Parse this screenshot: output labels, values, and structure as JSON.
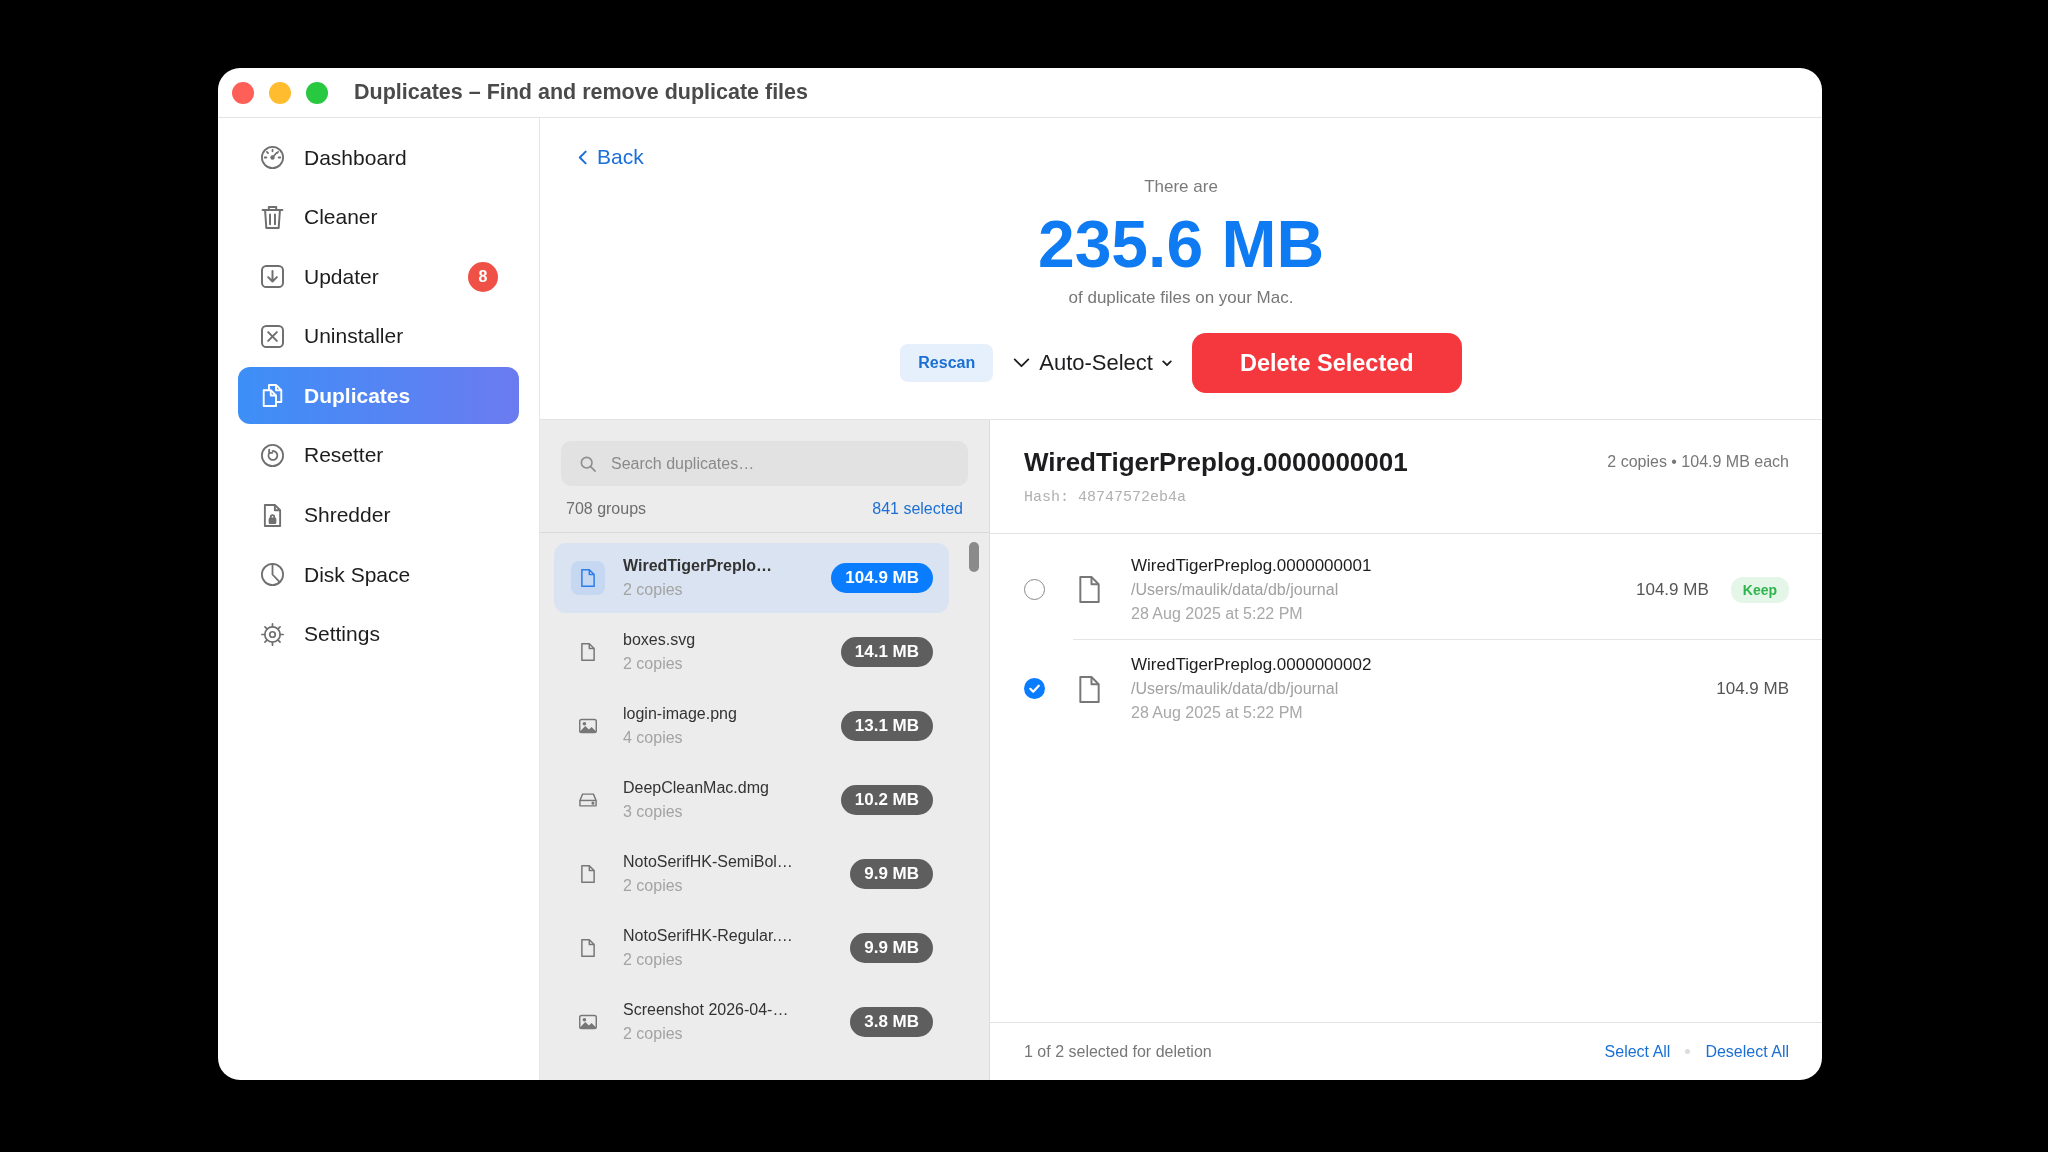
{
  "window": {
    "title": "Duplicates – Find and remove duplicate files"
  },
  "sidebar": {
    "items": [
      {
        "label": "Dashboard",
        "selected": false
      },
      {
        "label": "Cleaner",
        "selected": false
      },
      {
        "label": "Updater",
        "selected": false,
        "badge": "8"
      },
      {
        "label": "Uninstaller",
        "selected": false
      },
      {
        "label": "Duplicates",
        "selected": true
      },
      {
        "label": "Resetter",
        "selected": false
      },
      {
        "label": "Shredder",
        "selected": false
      },
      {
        "label": "Disk Space",
        "selected": false
      },
      {
        "label": "Settings",
        "selected": false
      }
    ]
  },
  "header": {
    "back": "Back",
    "intro": "There are",
    "total": "235.6 MB",
    "caption": "of duplicate files on your Mac.",
    "rescan": "Rescan",
    "auto_select": "Auto-Select",
    "delete": "Delete Selected"
  },
  "list": {
    "search": {
      "placeholder": "Search duplicates…"
    },
    "group_count": "708 groups",
    "selected_count": "841 selected",
    "rows": [
      {
        "name": "WiredTigerPreplo…",
        "copies": "2 copies",
        "size": "104.9 MB",
        "kind": "document",
        "selected": true
      },
      {
        "name": "boxes.svg",
        "copies": "2 copies",
        "size": "14.1 MB",
        "kind": "document",
        "selected": false
      },
      {
        "name": "login-image.png",
        "copies": "4 copies",
        "size": "13.1 MB",
        "kind": "image",
        "selected": false
      },
      {
        "name": "DeepCleanMac.dmg",
        "copies": "3 copies",
        "size": "10.2 MB",
        "kind": "disk",
        "selected": false
      },
      {
        "name": "NotoSerifHK-SemiBol…",
        "copies": "2 copies",
        "size": "9.9 MB",
        "kind": "document",
        "selected": false
      },
      {
        "name": "NotoSerifHK-Regular.…",
        "copies": "2 copies",
        "size": "9.9 MB",
        "kind": "document",
        "selected": false
      },
      {
        "name": "Screenshot 2026-04-…",
        "copies": "2 copies",
        "size": "3.8 MB",
        "kind": "image",
        "selected": false
      }
    ]
  },
  "detail": {
    "title": "WiredTigerPreplog.0000000001",
    "summary": "2 copies • 104.9 MB each",
    "hash": "Hash: 48747572eb4a",
    "copies": [
      {
        "name": "WiredTigerPreplog.0000000001",
        "path": "/Users/maulik/data/db/journal",
        "date": "28 Aug 2025 at 5:22 PM",
        "size": "104.9 MB",
        "checked": false,
        "tag": "Keep"
      },
      {
        "name": "WiredTigerPreplog.0000000002",
        "path": "/Users/maulik/data/db/journal",
        "date": "28 Aug 2025 at 5:22 PM",
        "size": "104.9 MB",
        "checked": true
      }
    ]
  },
  "footer": {
    "status": "1 of 2 selected for deletion",
    "select_all": "Select All",
    "deselect_all": "Deselect All"
  }
}
